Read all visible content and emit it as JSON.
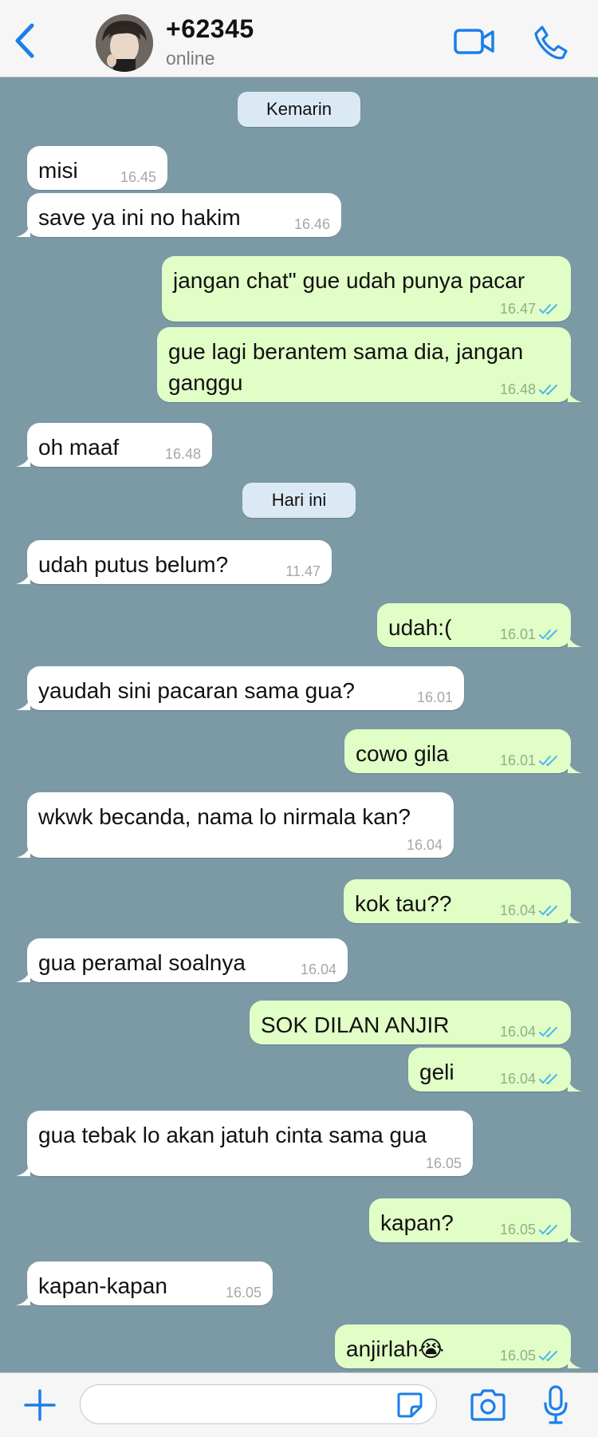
{
  "header": {
    "contact_name": "+62345",
    "status": "online"
  },
  "messages": [
    {
      "type": "date",
      "text": "Kemarin"
    },
    {
      "type": "in",
      "text": "misi",
      "time": "16.45"
    },
    {
      "type": "in",
      "text": "save ya ini no hakim",
      "time": "16.46"
    },
    {
      "type": "out",
      "text": "jangan chat\" gue udah punya pacar",
      "time": "16.47"
    },
    {
      "type": "out",
      "lines": [
        "gue lagi berantem sama dia, jangan",
        "ganggu"
      ],
      "time": "16.48"
    },
    {
      "type": "in",
      "text": "oh maaf",
      "time": "16.48"
    },
    {
      "type": "date",
      "text": "Hari ini"
    },
    {
      "type": "in",
      "text": "udah putus belum?",
      "time": "11.47"
    },
    {
      "type": "out",
      "text": "udah:(",
      "time": "16.01"
    },
    {
      "type": "in",
      "text": "yaudah sini pacaran sama gua?",
      "time": "16.01"
    },
    {
      "type": "out",
      "text": "cowo gila",
      "time": "16.01"
    },
    {
      "type": "in",
      "text": "wkwk becanda, nama lo nirmala kan?",
      "time": "16.04"
    },
    {
      "type": "out",
      "text": "kok tau??",
      "time": "16.04"
    },
    {
      "type": "in",
      "text": "gua peramal soalnya",
      "time": "16.04"
    },
    {
      "type": "out",
      "text": "SOK DILAN ANJIR",
      "time": "16.04"
    },
    {
      "type": "out",
      "text": "geli",
      "time": "16.04"
    },
    {
      "type": "in",
      "text": "gua tebak lo akan jatuh cinta sama gua",
      "time": "16.05"
    },
    {
      "type": "out",
      "text": "kapan?",
      "time": "16.05"
    },
    {
      "type": "in",
      "text": "kapan-kapan",
      "time": "16.05"
    },
    {
      "type": "out",
      "text": "anjirlah😭",
      "time": "16.05"
    }
  ],
  "composer": {
    "placeholder": ""
  },
  "colors": {
    "chat_background": "#7b9aa6",
    "incoming_bubble": "#ffffff",
    "outgoing_bubble": "#e1fec6",
    "date_chip": "#dbe9f5",
    "accent": "#1a7fe8",
    "read_ticks": "#4fb5f0"
  },
  "icons": {
    "back": "chevron-left-icon",
    "video": "video-camera-icon",
    "call": "phone-icon",
    "attach": "plus-icon",
    "sticker": "sticker-icon",
    "camera": "camera-icon",
    "mic": "microphone-icon"
  }
}
